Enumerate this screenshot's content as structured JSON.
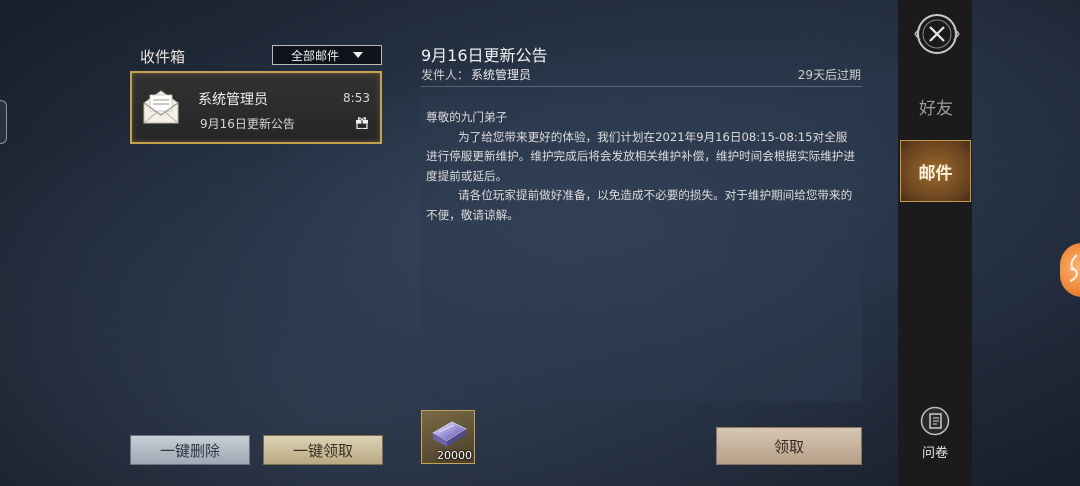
{
  "inbox": {
    "title": "收件箱",
    "filter_value": "全部邮件",
    "items": [
      {
        "sender": "系统管理员",
        "time": "8:53",
        "subject": "9月16日更新公告"
      }
    ],
    "delete_all_label": "一键删除",
    "claim_all_label": "一键领取"
  },
  "mail": {
    "title": "9月16日更新公告",
    "sender_prefix": "发件人：",
    "sender_name": "系统管理员",
    "expiry": "29天后过期",
    "body": [
      "尊敬的九门弟子",
      "为了给您带来更好的体验，我们计划在2021年9月16日08:15-08:15对全服进行停服更新维护。维护完成后将会发放相关维护补偿，维护时间会根据实际维护进度提前或延后。",
      "请各位玩家提前做好准备，以免造成不必要的损失。对于维护期间给您带来的不便，敬请谅解。"
    ],
    "attachment": {
      "icon": "silver-ingot-icon",
      "count": "20000"
    },
    "claim_label": "领取"
  },
  "side_nav": {
    "friends_label": "好友",
    "mail_label": "邮件",
    "survey_label": "问卷"
  },
  "colors": {
    "accent_gold": "#c6a14f",
    "active_tab": "#9b6a2c",
    "background": "#232e3f"
  }
}
